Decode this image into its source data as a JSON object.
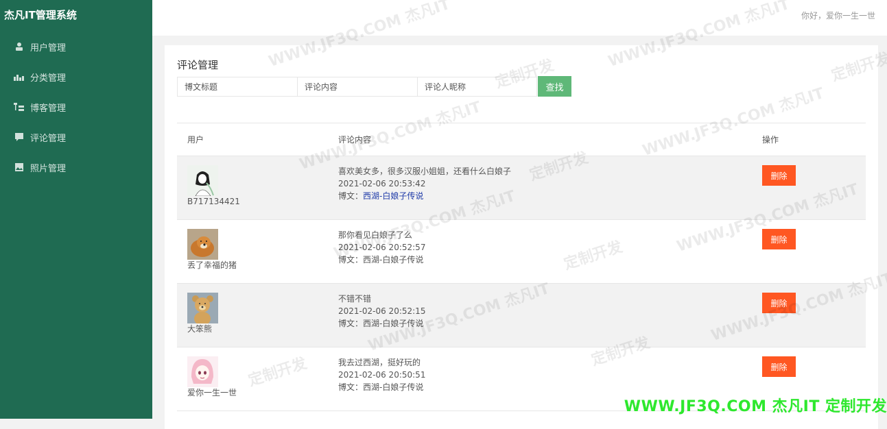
{
  "brand": "杰凡IT管理系统",
  "header": {
    "greeting": "你好，爱你一生一世"
  },
  "sidebar": {
    "items": [
      {
        "label": "用户管理",
        "icon": "user-icon"
      },
      {
        "label": "分类管理",
        "icon": "chart-bars-icon"
      },
      {
        "label": "博客管理",
        "icon": "tree-icon"
      },
      {
        "label": "评论管理",
        "icon": "comment-icon"
      },
      {
        "label": "照片管理",
        "icon": "image-icon"
      }
    ]
  },
  "page": {
    "title": "评论管理",
    "search": {
      "title_placeholder": "博文标题",
      "content_placeholder": "评论内容",
      "nickname_placeholder": "评论人昵称",
      "button": "查找"
    },
    "table": {
      "headers": {
        "user": "用户",
        "content": "评论内容",
        "op": "操作"
      },
      "rows": [
        {
          "user": "B717134421",
          "avatar": "sketch-girl",
          "comment": "喜欢美女多，很多汉服小姐姐，还看什么白娘子",
          "time": "2021-02-06 20:53:42",
          "blog_prefix": "博文：",
          "blog": "西湖-白娘子传说",
          "delete": "删除"
        },
        {
          "user": "丢了幸福的猪",
          "avatar": "dog",
          "comment": "那你看见白娘子了么",
          "time": "2021-02-06 20:52:57",
          "blog_prefix": "博文：",
          "blog": "西湖-白娘子传说",
          "delete": "删除"
        },
        {
          "user": "大笨熊",
          "avatar": "teddy-bear",
          "comment": "不错不错",
          "time": "2021-02-06 20:52:15",
          "blog_prefix": "博文：",
          "blog": "西湖-白娘子传说",
          "delete": "删除"
        },
        {
          "user": "爱你一生一世",
          "avatar": "anime-girl",
          "comment": "我去过西湖，挺好玩的",
          "time": "2021-02-06 20:50:51",
          "blog_prefix": "博文：",
          "blog": "西湖-白娘子传说",
          "delete": "删除"
        }
      ]
    }
  },
  "watermark": {
    "text_a": "WWW.JF3Q.COM 杰凡IT",
    "text_b": "定制开发",
    "footer": "WWW.JF3Q.COM 杰凡IT  定制开发"
  },
  "colors": {
    "sidebar": "#1f6b52",
    "search_button": "#5fb878",
    "delete_button": "#ff5722",
    "footer_watermark": "#2ee82e"
  }
}
